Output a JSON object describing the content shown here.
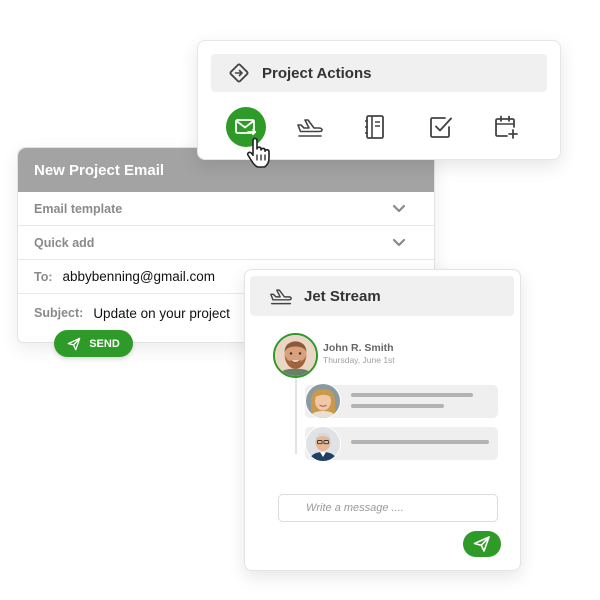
{
  "colors": {
    "accent_green": "#2e9a27",
    "email_header_bg": "#a3a3a3",
    "panel_header_bg": "#f0f0f0",
    "muted_text": "#8a8a8a"
  },
  "project_actions": {
    "title": "Project Actions",
    "header_icon": "diamond-arrow-icon",
    "icons": [
      {
        "name": "email-icon",
        "active": true
      },
      {
        "name": "plane-icon",
        "active": false
      },
      {
        "name": "notebook-icon",
        "active": false
      },
      {
        "name": "checkbox-icon",
        "active": false
      },
      {
        "name": "calendar-add-icon",
        "active": false
      }
    ]
  },
  "email": {
    "title": "New Project Email",
    "template_label": "Email template",
    "quick_add_label": "Quick add",
    "to_label": "To:",
    "to_value": "abbybenning@gmail.com",
    "subject_label": "Subject:",
    "subject_value": "Update on your project",
    "send_label": "SEND"
  },
  "jet_stream": {
    "title": "Jet Stream",
    "header_icon": "plane-icon",
    "sender_name": "John R. Smith",
    "sender_date": "Thursday, June 1st",
    "message_placeholder": "Write a message ...."
  }
}
